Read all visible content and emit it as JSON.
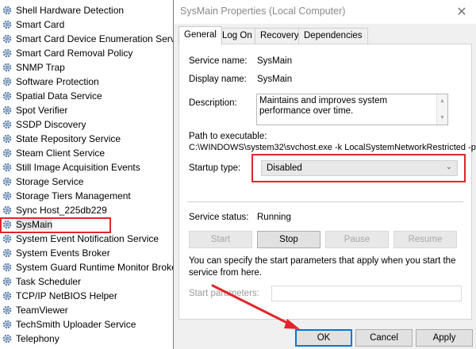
{
  "services": {
    "items": [
      "Shell Hardware Detection",
      "Smart Card",
      "Smart Card Device Enumeration Service",
      "Smart Card Removal Policy",
      "SNMP Trap",
      "Software Protection",
      "Spatial Data Service",
      "Spot Verifier",
      "SSDP Discovery",
      "State Repository Service",
      "Steam Client Service",
      "Still Image Acquisition Events",
      "Storage Service",
      "Storage Tiers Management",
      "Sync Host_225db229",
      "SysMain",
      "System Event Notification Service",
      "System Events Broker",
      "System Guard Runtime Monitor Broker",
      "Task Scheduler",
      "TCP/IP NetBIOS Helper",
      "TeamViewer",
      "TechSmith Uploader Service",
      "Telephony"
    ],
    "selected": "SysMain"
  },
  "dialog": {
    "title": "SysMain Properties (Local Computer)",
    "close_glyph": "✕",
    "tabs": [
      "General",
      "Log On",
      "Recovery",
      "Dependencies"
    ],
    "active_tab": "General",
    "service_name_label": "Service name:",
    "service_name": "SysMain",
    "display_name_label": "Display name:",
    "display_name": "SysMain",
    "description_label": "Description:",
    "description": "Maintains and improves system performance over time.",
    "path_label": "Path to executable:",
    "path": "C:\\WINDOWS\\system32\\svchost.exe -k LocalSystemNetworkRestricted -p",
    "startup_type_label": "Startup type:",
    "startup_type": "Disabled",
    "status_label": "Service status:",
    "status": "Running",
    "buttons": {
      "start": "Start",
      "stop": "Stop",
      "pause": "Pause",
      "resume": "Resume"
    },
    "info": "You can specify the start parameters that apply when you start the service from here.",
    "start_params_label": "Start parameters:",
    "footer": {
      "ok": "OK",
      "cancel": "Cancel",
      "apply": "Apply"
    }
  },
  "colors": {
    "highlight_red": "#e0262c",
    "dialog_bg": "#f0f0f0",
    "default_button_border": "#0078d7"
  }
}
